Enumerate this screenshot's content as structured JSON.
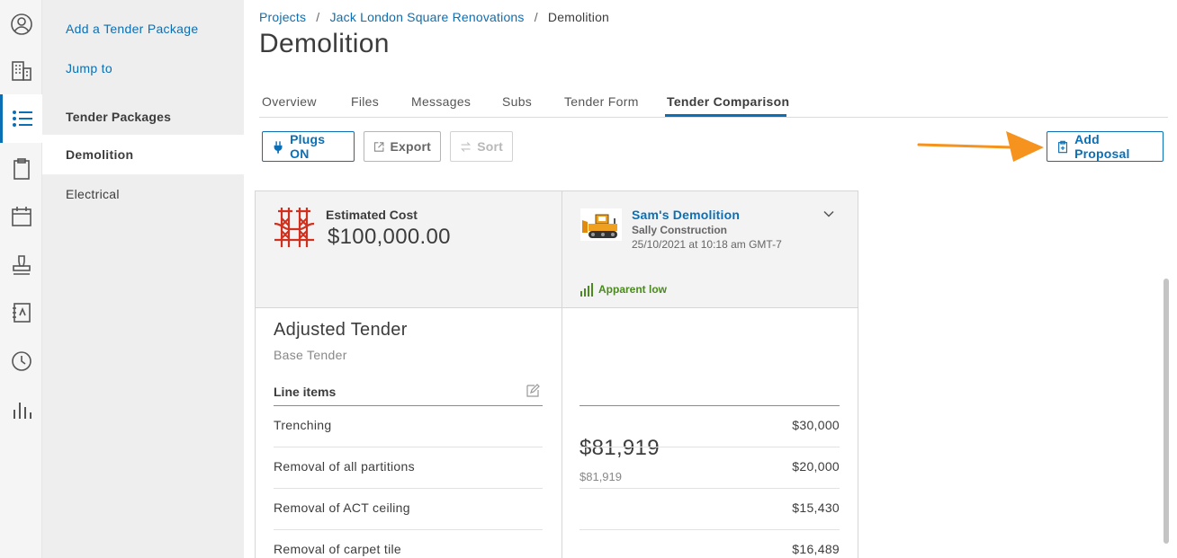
{
  "rail": {
    "items": [
      "profile-icon",
      "building-icon",
      "list-icon",
      "clipboard-icon",
      "calendar-icon",
      "stamp-icon",
      "notebook-icon",
      "clock-icon",
      "bar-chart-icon"
    ],
    "active_index": 2
  },
  "sidebar": {
    "add_link": "Add a Tender Package",
    "jump_link": "Jump to",
    "section_title": "Tender Packages",
    "items": [
      {
        "label": "Demolition",
        "active": true
      },
      {
        "label": "Electrical",
        "active": false
      }
    ]
  },
  "breadcrumb": {
    "items": [
      "Projects",
      "Jack London Square Renovations"
    ],
    "current": "Demolition",
    "separator": "/"
  },
  "page_title": "Demolition",
  "tabs": [
    "Overview",
    "Files",
    "Messages",
    "Subs",
    "Tender Form",
    "Tender Comparison"
  ],
  "active_tab": "Tender Comparison",
  "toolbar": {
    "plugs_label": "Plugs ON",
    "export_label": "Export",
    "sort_label": "Sort",
    "add_proposal_label": "Add Proposal"
  },
  "estimate": {
    "label": "Estimated Cost",
    "value": "$100,000.00"
  },
  "bid": {
    "name": "Sam's Demolition",
    "company": "Sally Construction",
    "date": "25/10/2021 at 10:18 am GMT-7",
    "badge": "Apparent low",
    "total": "$81,919",
    "total_sub": "$81,919"
  },
  "adjusted": {
    "title": "Adjusted Tender",
    "subtitle": "Base Tender",
    "line_items_header": "Line items"
  },
  "line_items": [
    {
      "name": "Trenching",
      "value": "$30,000"
    },
    {
      "name": "Removal of all partitions",
      "value": "$20,000"
    },
    {
      "name": "Removal of ACT ceiling",
      "value": "$15,430"
    },
    {
      "name": "Removal of carpet tile",
      "value": "$16,489"
    }
  ],
  "colors": {
    "accent": "#0a6fb5",
    "positive": "#4a8a1e",
    "annotation_arrow": "#f5931e"
  }
}
